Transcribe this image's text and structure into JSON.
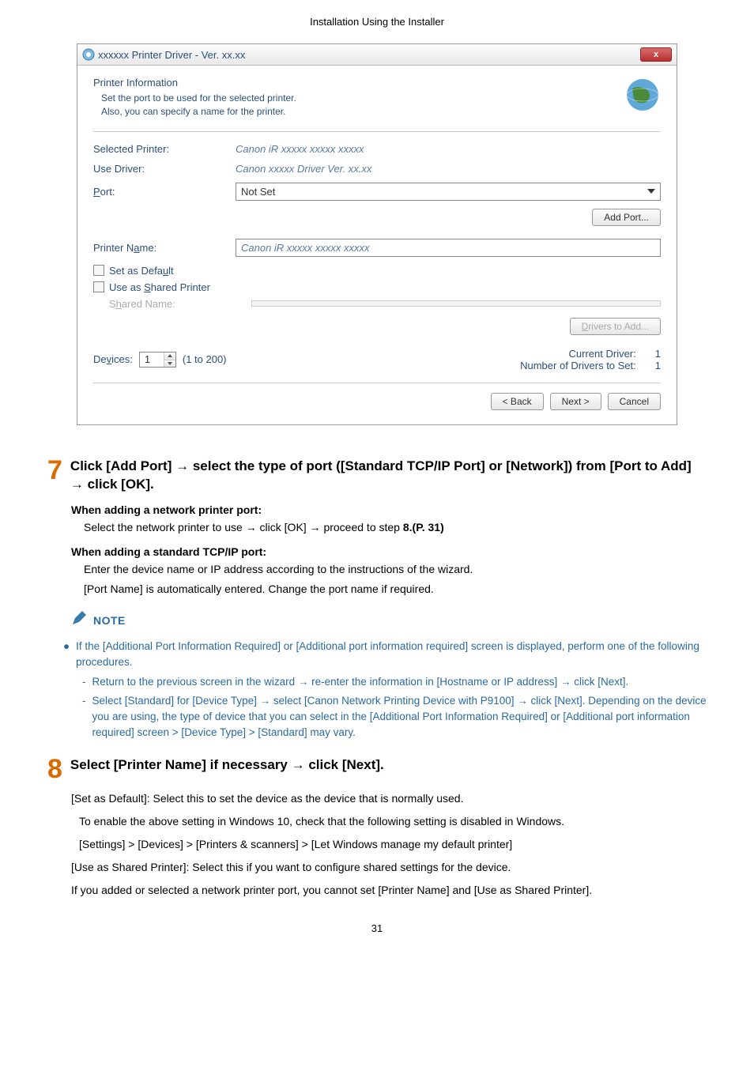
{
  "page_header": "Installation Using the Installer",
  "dialog": {
    "title": "xxxxxx Printer Driver - Ver. xx.xx",
    "close_glyph": "x",
    "section_title": "Printer Information",
    "section_sub": "Set the port to be used for the selected printer.\nAlso, you can specify a name for the printer.",
    "labels": {
      "selected_printer": "Selected Printer:",
      "use_driver": "Use Driver:",
      "port": "Port:",
      "printer_name": "Printer Name:",
      "set_default": "Set as Default",
      "shared_printer": "Use as Shared Printer",
      "shared_name": "Shared Name:",
      "devices": "Devices:",
      "devices_range": "(1 to 200)",
      "current_driver": "Current Driver:",
      "num_drivers": "Number of Drivers to Set:"
    },
    "values": {
      "selected_printer": "Canon iR xxxxx xxxxx xxxxx",
      "use_driver": "Canon xxxxx Driver Ver. xx.xx",
      "port": "Not Set",
      "printer_name": "Canon iR xxxxx xxxxx xxxxx",
      "devices": "1",
      "current_driver": "1",
      "num_drivers": "1"
    },
    "buttons": {
      "add_port": "Add Port...",
      "drivers_to_add": "Drivers to Add...",
      "back": "< Back",
      "next": "Next >",
      "cancel": "Cancel"
    }
  },
  "step7": {
    "num": "7",
    "title": "Click [Add Port] → select the type of port ([Standard TCP/IP Port] or [Network]) from [Port to Add] → click [OK].",
    "sub1_head": "When adding a network printer port:",
    "sub1_body_a": "Select the network printer to use → click [OK] → proceed to step ",
    "sub1_body_b": "8.(P. 31)",
    "sub2_head": "When adding a standard TCP/IP port:",
    "sub2_body1": "Enter the device name or IP address according to the instructions of the wizard.",
    "sub2_body2": "[Port Name] is automatically entered. Change the port name if required."
  },
  "note": {
    "label": "NOTE",
    "bullet1": "If the [Additional Port Information Required] or [Additional port information required] screen is displayed, perform one of the following procedures.",
    "dash1": "Return to the previous screen in the wizard → re-enter the information in [Hostname or IP address] → click [Next].",
    "dash2": "Select [Standard] for [Device Type] → select [Canon Network Printing Device with P9100] → click [Next]. Depending on the device you are using, the type of device that you can select in the [Additional Port Information Required] or [Additional port information required] screen > [Device Type] > [Standard] may vary."
  },
  "step8": {
    "num": "8",
    "title": "Select [Printer Name] if necessary → click [Next].",
    "p1": "[Set as Default]: Select this to set the device as the device that is normally used.",
    "p2": "To enable the above setting in Windows 10, check that the following setting is disabled in Windows.",
    "p3": "[Settings] > [Devices] > [Printers & scanners] > [Let Windows manage my default printer]",
    "p4": "[Use as Shared Printer]: Select this if you want to configure shared settings for the device.",
    "p5": "If you added or selected a network printer port, you cannot set [Printer Name] and [Use as Shared Printer]."
  },
  "page_number": "31"
}
